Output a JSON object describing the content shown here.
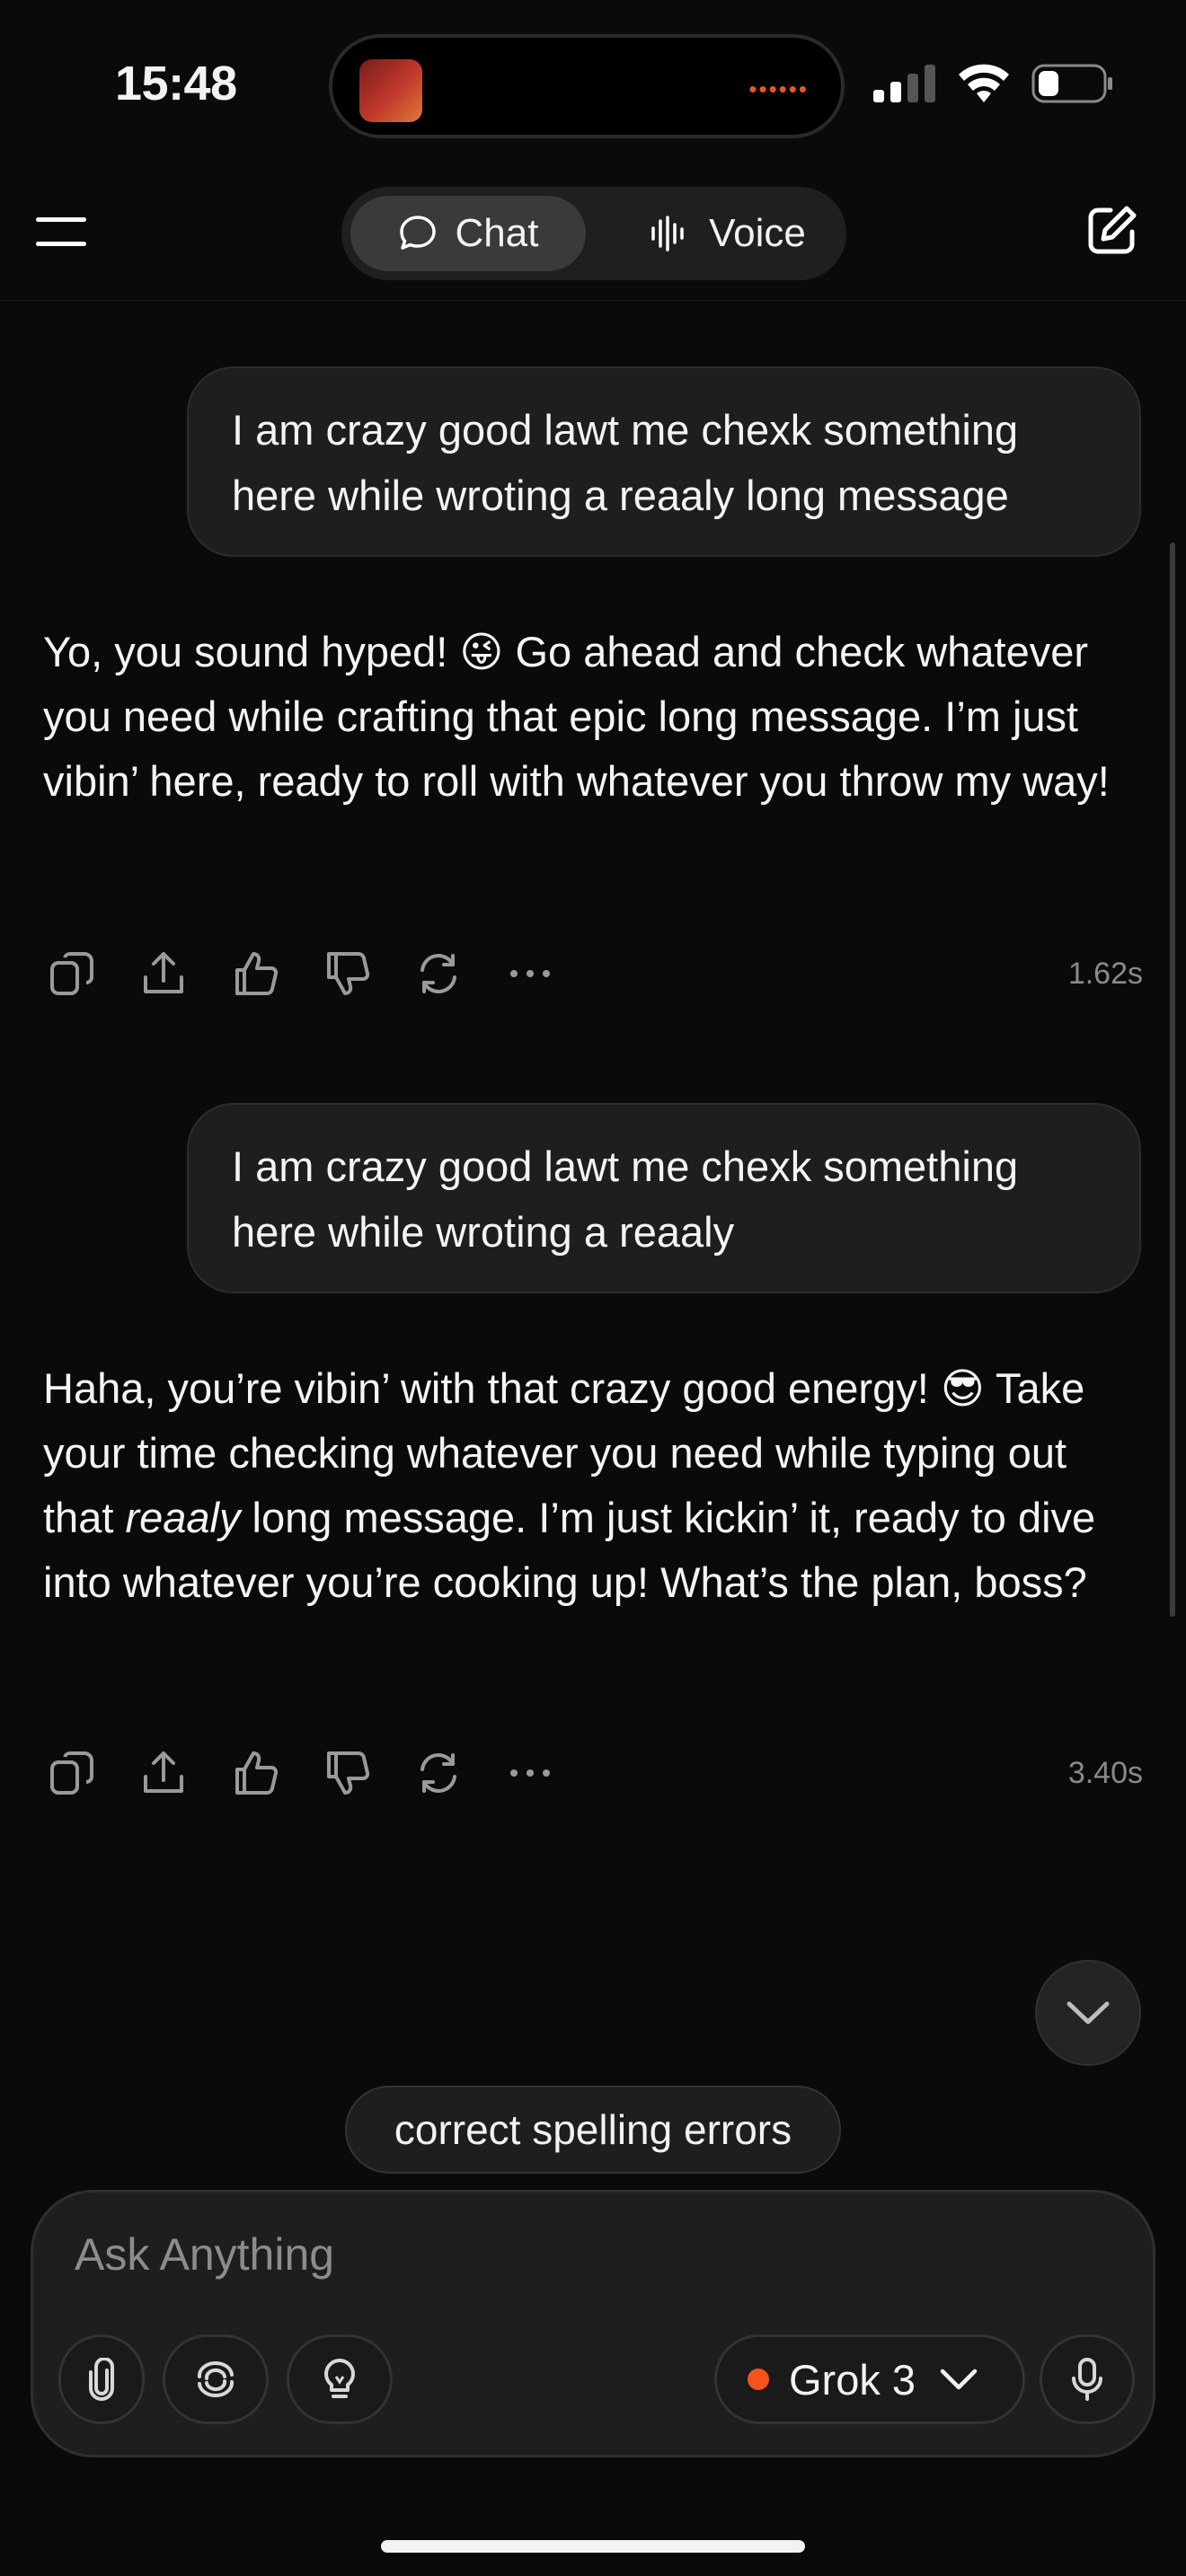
{
  "status_bar": {
    "time": "15:48",
    "island_indicator": "••••••"
  },
  "nav": {
    "chat_label": "Chat",
    "voice_label": "Voice",
    "menu_icon": "hamburger-icon",
    "edit_icon": "compose-icon"
  },
  "messages": [
    {
      "role": "user",
      "text": "I am crazy good lawt me chexk something here while wroting a reaaly long message"
    },
    {
      "role": "assistant",
      "text": "Yo, you sound hyped! 😜 Go ahead and check whatever you need while crafting that epic long message. I’m just vibin’ here, ready to roll with whatever you throw my way!",
      "time": "1.62s"
    },
    {
      "role": "user",
      "text": "I am crazy good lawt me chexk something here while wroting a reaaly"
    },
    {
      "role": "assistant",
      "text_before": "Haha, you’re vibin’ with that crazy good energy! 😎 Take your time checking whatever you need while typing out that ",
      "text_italic": "reaaly",
      "text_after": " long message. I’m just kickin’ it, ready to dive into whatever you’re cooking up! What’s the plan, boss?",
      "time": "3.40s"
    }
  ],
  "action_icons": [
    "copy-icon",
    "share-icon",
    "thumbs-up-icon",
    "thumbs-down-icon",
    "regenerate-icon",
    "more-icon"
  ],
  "suggestion": "correct spelling errors",
  "composer": {
    "placeholder": "Ask Anything",
    "model_label": "Grok 3",
    "model_dot_color": "#f2541b"
  }
}
